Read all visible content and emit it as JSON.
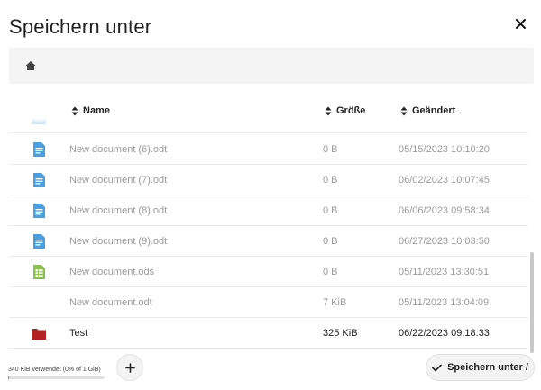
{
  "dialog": {
    "title": "Speichern unter",
    "close_icon": "close-icon",
    "breadcrumb_icon": "home-icon"
  },
  "columns": {
    "name": "Name",
    "size": "Größe",
    "modified": "Geändert"
  },
  "files": [
    {
      "icon": "document-icon",
      "name": "New document (6).odt",
      "size": "0 B",
      "modified": "05/15/2023 10:10:20",
      "active": false
    },
    {
      "icon": "document-icon",
      "name": "New document (7).odt",
      "size": "0 B",
      "modified": "06/02/2023 10:07:45",
      "active": false
    },
    {
      "icon": "document-icon",
      "name": "New document (8).odt",
      "size": "0 B",
      "modified": "06/06/2023 09:58:34",
      "active": false
    },
    {
      "icon": "document-icon",
      "name": "New document (9).odt",
      "size": "0 B",
      "modified": "06/27/2023 10:03:50",
      "active": false
    },
    {
      "icon": "spreadsheet-icon",
      "name": "New document.ods",
      "size": "0 B",
      "modified": "05/11/2023 13:30:51",
      "active": false
    },
    {
      "icon": "blank-icon",
      "name": "New document.odt",
      "size": "7 KiB",
      "modified": "05/11/2023 13:04:09",
      "active": false
    },
    {
      "icon": "folder-icon",
      "name": "Test",
      "size": "325 KiB",
      "modified": "06/22/2023 09:18:33",
      "active": true
    }
  ],
  "footer": {
    "quota_text": "340 KiB verwendet (0% of 1 GiB)",
    "quota_fraction": 0.003,
    "add_icon": "plus-icon",
    "save_label": "Speichern unter /"
  },
  "colors": {
    "document": "#4a9fe0",
    "spreadsheet": "#8cc152",
    "folder": "#b22222",
    "accent": "#0082c9"
  }
}
